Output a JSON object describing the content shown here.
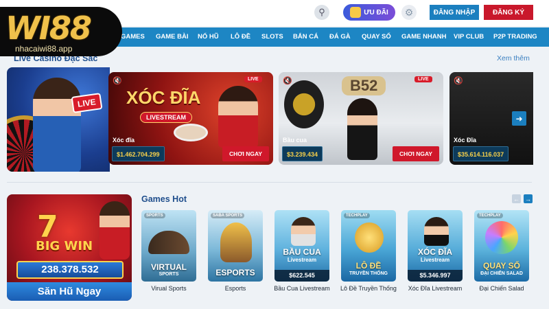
{
  "brand": {
    "logo": "WI88",
    "url": "nhacaiwi88.app"
  },
  "header": {
    "promo_label": "ƯU ĐÃI",
    "login_label": "ĐĂNG NHẬP",
    "register_label": "ĐĂNG KÝ"
  },
  "nav": {
    "items": [
      "GAMES",
      "GAME BÀI",
      "NỔ HŨ",
      "LÔ ĐỀ",
      "SLOTS",
      "BẮN CÁ",
      "ĐÁ GÀ",
      "QUAY SỐ",
      "GAME NHANH",
      "VIP CLUB",
      "P2P TRADING"
    ]
  },
  "live_casino": {
    "title": "Live Casino Đặc Sắc",
    "see_more": "Xem thêm",
    "banner_tag": "LIVE",
    "cards": [
      {
        "big_title": "XÓC ĐĨA",
        "sub": "LIVESTREAM",
        "name": "Xóc đĩa",
        "amount": "$1.462.704.299",
        "play": "CHƠI NGAY",
        "live": "LIVE"
      },
      {
        "big_title": "B52",
        "sub": "",
        "name": "Bầu cua",
        "amount": "$3.239.434",
        "play": "CHƠI NGAY",
        "live": "LIVE"
      },
      {
        "big_title": "",
        "sub": "",
        "name": "Xóc Đĩa",
        "amount": "$35.614.116.037",
        "play": "",
        "live": ""
      }
    ]
  },
  "games_hot": {
    "title": "Games Hot",
    "jackpot": {
      "big_win": "BIG WIN",
      "amount": "238.378.532",
      "cta": "Săn Hũ Ngay"
    },
    "tiles": [
      {
        "provider": "SPORTS",
        "title": "VIRTUAL",
        "sub": "SPORTS",
        "price": "",
        "label": "Virual Sports"
      },
      {
        "provider": "SABA SPORTS",
        "title": "ESPORTS",
        "sub": "",
        "price": "",
        "label": "Esports"
      },
      {
        "provider": "",
        "title": "BẦU CUA",
        "sub": "Livestream",
        "price": "$622.545",
        "label": "Bầu Cua Livestream"
      },
      {
        "provider": "TECHPLAY",
        "title": "LÔ ĐỀ",
        "sub": "TRUYỀN THỐNG",
        "price": "",
        "label": "Lô Đề Truyền Thống"
      },
      {
        "provider": "",
        "title": "XÓC ĐĨA",
        "sub": "Livestream",
        "price": "$5.346.997",
        "label": "Xóc Đĩa Livestream"
      },
      {
        "provider": "TECHPLAY",
        "title": "QUAY SỐ",
        "sub": "ĐẠI CHIẾN SALAD",
        "price": "",
        "label": "Đại Chiến Salad"
      }
    ]
  },
  "colors": {
    "primary": "#1d86c4",
    "danger": "#c9182b",
    "gold": "#f0c14b"
  }
}
